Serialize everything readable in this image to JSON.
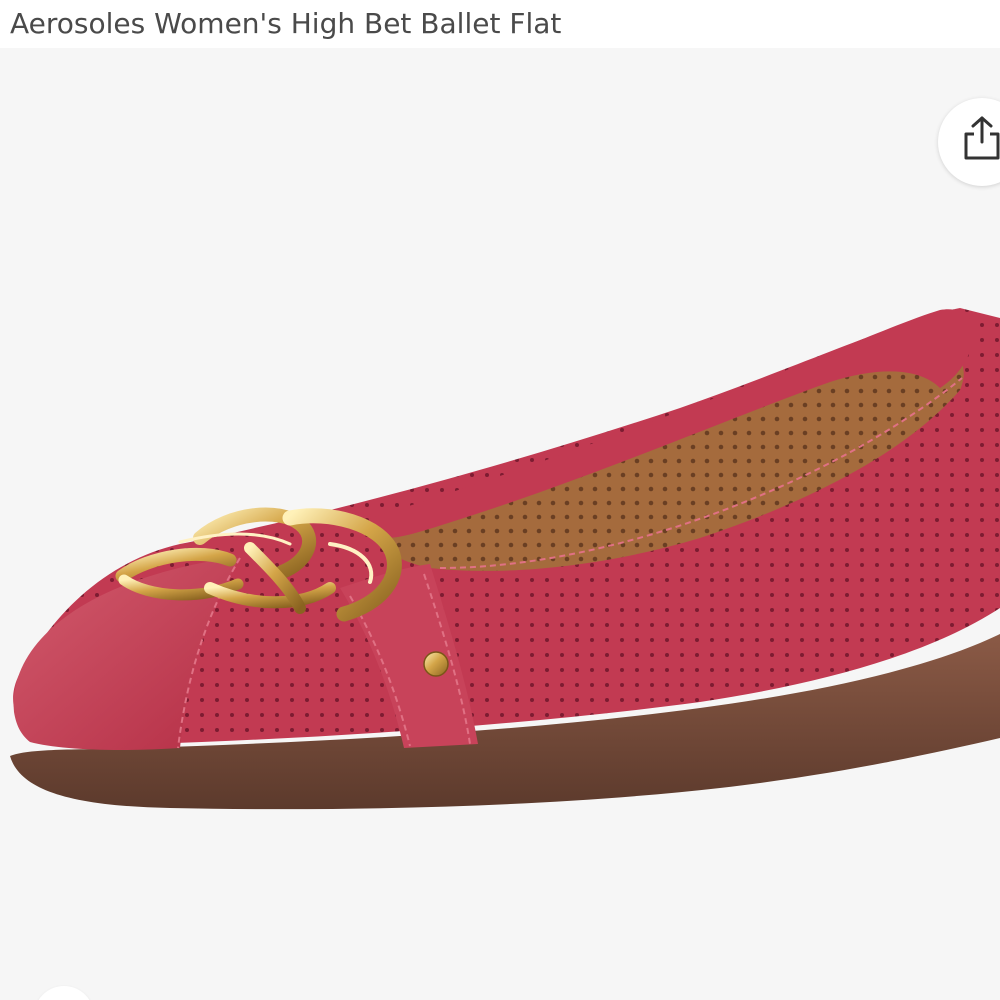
{
  "product": {
    "title": "Aerosoles Women's High Bet Ballet Flat",
    "image_alt": "Aerosoles Women's High Bet Ballet Flat",
    "color_name": "pink",
    "upper_color": "#c4394f",
    "sole_color": "#7a4f40",
    "hardware_color": "#d8b35a"
  },
  "actions": {
    "share_icon": "share-icon"
  }
}
